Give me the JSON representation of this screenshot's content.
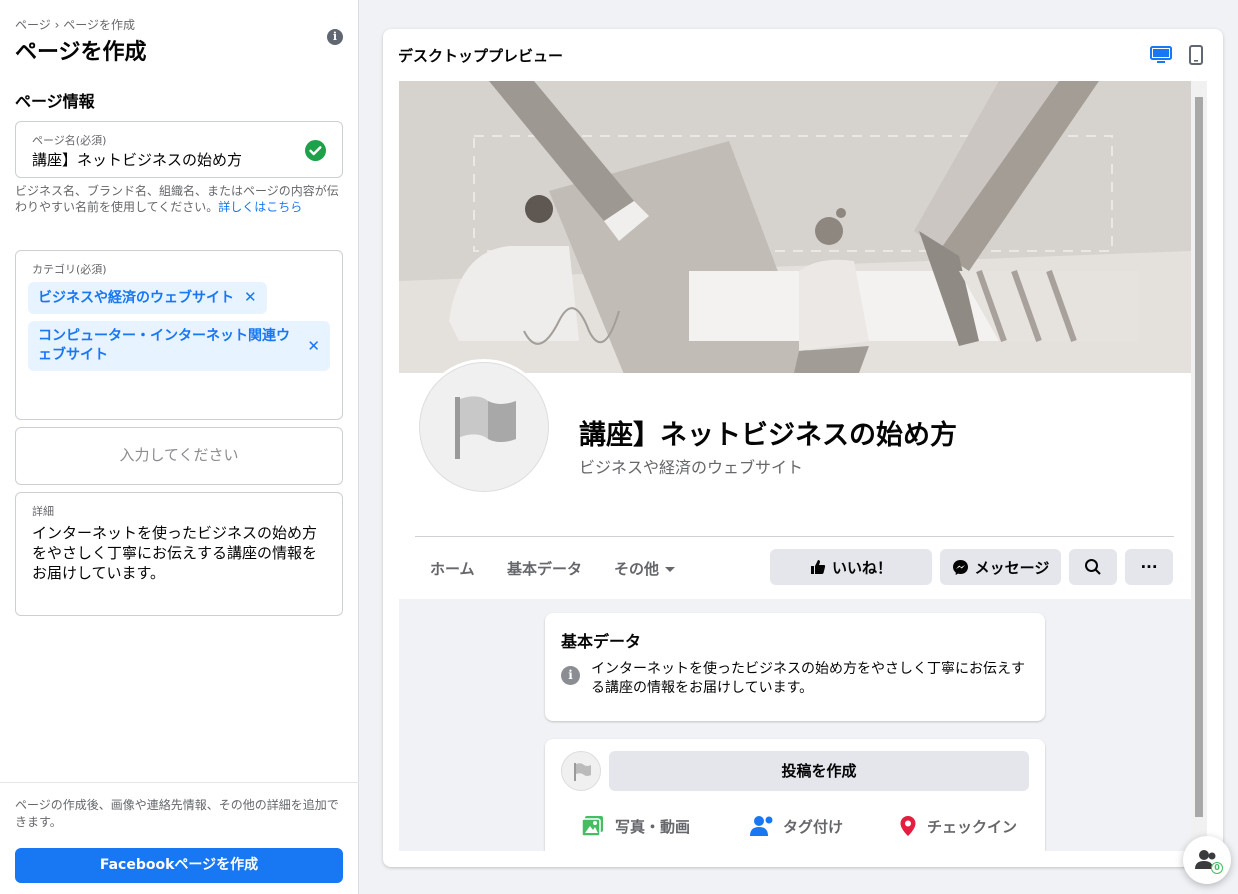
{
  "left_panel": {
    "breadcrumb": "ページ › ページを作成",
    "title": "ページを作成",
    "section_title": "ページ情報",
    "page_name": {
      "label": "ページ名(必須)",
      "value": "講座】ネットビジネスの始め方"
    },
    "help_text": "ビジネス名、ブランド名、組織名、またはページの内容が伝わりやすい名前を使用してください。",
    "help_link": "詳しくはこちら",
    "category": {
      "label": "カテゴリ(必須)",
      "chips": [
        "ビジネスや経済のウェブサイト",
        "コンピューター・インターネット関連ウェブサイト"
      ],
      "remove_glyph": "✕"
    },
    "input_placeholder": "入力してください",
    "details": {
      "label": "詳細",
      "value": "インターネットを使ったビジネスの始め方をやさしく丁寧にお伝えする講座の情報をお届けしています。"
    },
    "bottom_note": "ページの作成後、画像や連絡先情報、その他の詳細を追加できます。",
    "create_button": "Facebookページを作成",
    "info_glyph": "i"
  },
  "preview": {
    "title": "デスクトッププレビュー",
    "page_name": "講座】ネットビジネスの始め方",
    "page_category": "ビジネスや経済のウェブサイト",
    "tabs": [
      "ホーム",
      "基本データ",
      "その他"
    ],
    "actions": {
      "like": "いいね！",
      "message": "メッセージ",
      "more": "···"
    },
    "about_card": {
      "title": "基本データ",
      "text": "インターネットを使ったビジネスの始め方をやさしく丁寧にお伝えする講座の情報をお届けしています。"
    },
    "composer": {
      "create_post": "投稿を作成",
      "photo_video": "写真・動画",
      "tag": "タグ付け",
      "checkin": "チェックイン"
    }
  },
  "floating": {
    "badge": "0"
  },
  "colors": {
    "accent": "#1877f2",
    "success": "#1ea14a",
    "checkin": "#e41e3f",
    "photo": "#45bd62"
  }
}
